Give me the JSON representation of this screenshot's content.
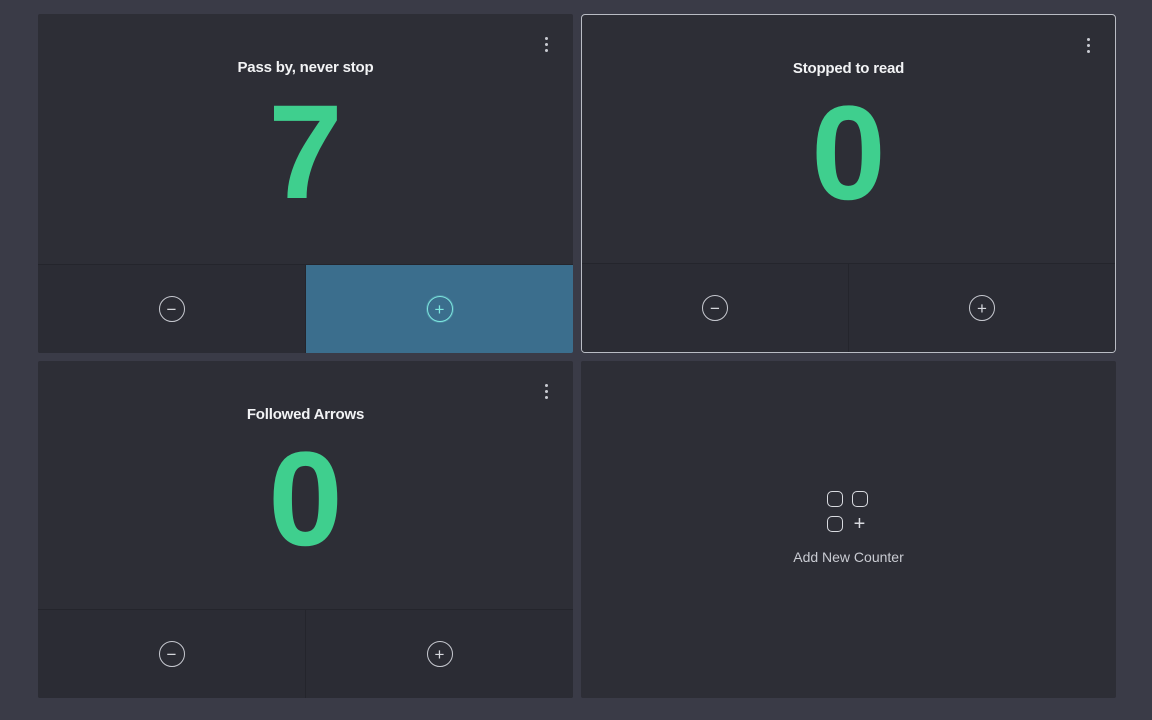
{
  "counters": [
    {
      "title": "Pass by, never stop",
      "value": "7",
      "decrement_symbol": "−",
      "increment_symbol": "+"
    },
    {
      "title": "Stopped to read",
      "value": "0",
      "decrement_symbol": "−",
      "increment_symbol": "+"
    },
    {
      "title": "Followed Arrows",
      "value": "0",
      "decrement_symbol": "−",
      "increment_symbol": "+"
    }
  ],
  "add_counter": {
    "label": "Add New Counter",
    "plus_symbol": "+"
  },
  "colors": {
    "background": "#3a3b47",
    "card": "#2d2e36",
    "count_green": "#3fcf8e",
    "active_button": "#3b6e8d",
    "active_accent": "#7de7e0"
  },
  "icons": [
    "more-vertical-icon",
    "minus-circle-icon",
    "plus-circle-icon",
    "add-grid-icon"
  ]
}
